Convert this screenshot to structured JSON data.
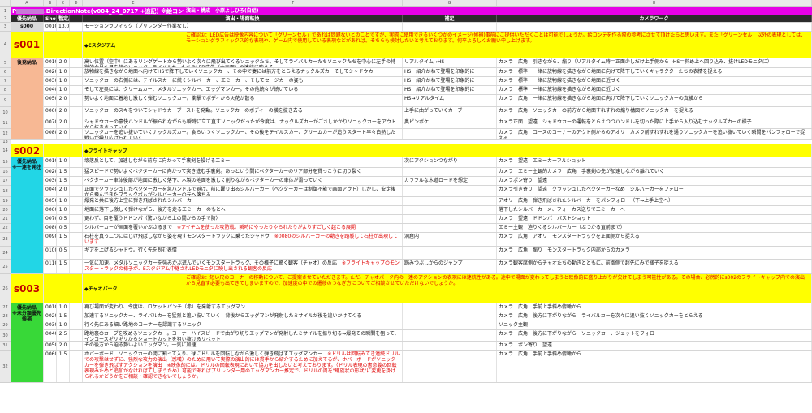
{
  "columns": [
    "A",
    "B",
    "C",
    "D",
    "E",
    "F",
    "G",
    "H"
  ],
  "title": {
    "prefix": "P",
    "name": ".DirectionNote(v004_24_0717 +追記) ※絵コンテ作成用",
    "credit": "演出・構成　小原よしひろ(白組)"
  },
  "headers": [
    "優先納品",
    "Shot",
    "暫定尺",
    "",
    "演出・場面転換",
    "補足",
    "カメラワーク"
  ],
  "rows": [
    {
      "n": 3,
      "kind": "data",
      "h": 11,
      "label": "s000",
      "shot": "0010",
      "dur": "13.0",
      "desc": "モーションラフィック（プリレンダー作業なし）"
    },
    {
      "n": 4,
      "kind": "scene",
      "h": 33,
      "scene": "s001",
      "title": "◆Eスタジアム",
      "note": "ご確認①：LED広告は映像内容について「グリーンセル」であれば問題ないとのことですが、実際に使用できるいくつかのイメージ(候補)事前にご提供いただくことは可能でしょうか。絵コンテを作る際の参考にさせて頂けたらと思います。また「グリーンセル」以外の表現としては、モーショングラフィックス的な表現や、ゲーム内で使用している表現などがあれば。そちらも検討したいと考えております。何卒よろしくお願い申し上げます。"
    },
    {
      "n": 5,
      "kind": "data",
      "h": 12,
      "label": "後発納品",
      "shot": "0010",
      "dur": "2.0",
      "desc": "高い位置（空中）にあるリングゲートから勢いよく次々に飛び出てくるソニックたち。そしてライバルカーたちソニックたちを中心に左手の特徴的な見た目を持つソニック、ライバルカーたちのLED広告（大画面）の連続に映える",
      "g": "リアルタイム→HS",
      "h2": "カメラ　広角　引きながら、煽り（リアルタイム時＝正面少しだけ上手側から→HS＝斜め上ヘ回り込み、抜けLEDモニタに）"
    },
    {
      "n": 6,
      "kind": "data",
      "h": 11,
      "shot": "0020",
      "dur": "1.0",
      "desc": "放物線を描きながら地面へ向けてHSで降下していくソニックカー、その中で妻には前方をとらえるナックルズカーそしてシャドウカー",
      "g": "HS　紹介かねて登場を印象的に",
      "h2": "カメラ　標準　一緒に放物線を描きながら地面に向けて降下していくキャラクターたちの表情を捉える"
    },
    {
      "n": 7,
      "kind": "data",
      "h": 11,
      "shot": "0030",
      "dur": "1.0",
      "desc": "ソニックカーの右側には、テイルスカーに続くシルバーカー、エミーカー、そしてセージカーの姿も",
      "g": "HS　紹介かねて登場を印象的に",
      "h2": "カメラ　標準　一緒に放物線を描きながら地面に近づく"
    },
    {
      "n": 8,
      "kind": "data",
      "h": 11,
      "shot": "0040",
      "dur": "1.0",
      "desc": "そして左奥には、クリームカー、メタルソニックカー、エッグマンカー。その他続々が続いている",
      "g": "HS　紹介かねて登場を印象的に",
      "h2": "カメラ　標準　一緒に放物線を描きながら地面に近づく"
    },
    {
      "n": 9,
      "kind": "data",
      "h": 15,
      "shot": "0050",
      "dur": "2.0",
      "desc": "勢いよく地面に着地し激しく弾むソニックカー。衝撃でボディから火花が散る",
      "g": "HS→リアルタイム",
      "h2": "カメラ　広角　一緒に放物線を描きながら地面に向けて降下していくソニックカーの真横から"
    },
    {
      "n": 10,
      "kind": "data",
      "h": 14,
      "shot": "0060",
      "dur": "2.0",
      "desc": "ソニックカーのスキをついてシャドウカーブーストを発動。ソニックカーのボディーの横を抜き去る",
      "g": "上手に曲がっていくカーブ",
      "h2": "カメラ　広角　ソニックカーの前方から地面すれすれの煽り構図でソニックカーを捉える"
    },
    {
      "n": 11,
      "kind": "data",
      "h": 13,
      "shot": "0070",
      "dur": "2.0",
      "desc": "シャドウカーの豪快ハンドルが振られながらも瞬時に立て直すソニックだったが今度は、ナックルズカーがごさしかかりソニックカーをアウトから抜きさっていく",
      "g": "奥ピンボケ",
      "h2": "カメラ正面　望遠　シャドウカーの運転をとらえつつハンドルを切った際に上手から入り込むナックルズカーの様子"
    },
    {
      "n": 12,
      "kind": "data",
      "h": 13,
      "shot": "0080",
      "dur": "2.0",
      "desc": "ソニックカーを追い抜いていくナックルズカー。食らいつくソニックカー、その後をテイルスカー、クリームカーが追うスタート早々白熱した戦いが繰り広げられていく",
      "g": "",
      "h2": "カメラ　広角　コースのコーナーのアウト側からのアオリ　カメラ前すれすれを通りソニックカーを追い抜いていく瞬間をパンフォローで捉える"
    },
    {
      "n": 13,
      "kind": "spacer",
      "h": 6
    },
    {
      "n": 14,
      "kind": "scene",
      "h": 16,
      "scene": "s002",
      "title": "◆フライトキャップ",
      "note": ""
    },
    {
      "n": 15,
      "kind": "data",
      "h": 13,
      "label": "優先納品\n※一連を発注",
      "shot": "0010",
      "dur": "1.0",
      "desc": "壊落反として、加速しながら前方に向かって手裏剣を投げるエミー",
      "g": "次にアクションつながり",
      "h2": "カメラ　望遠　エミーカーフルショット"
    },
    {
      "n": 16,
      "kind": "data",
      "h": 11,
      "shot": "0020",
      "dur": "1.5",
      "desc": "猛スピードで勢いよくベクターカーに向かって突き進む手裏剣。あっという間にベクターカーのリア部分を貫っこうに切り裂く",
      "g": "",
      "h2": "カメラ　エミー主観的カメラ　広角　手裏剣の先が加速しながら離れていく"
    },
    {
      "n": 17,
      "kind": "data",
      "h": 11,
      "shot": "0030",
      "dur": "1.5",
      "desc": "ベクターカー車体後部が地面に激しく落下、木製の地面を激しく削りながらベクターカーの車体が滑っていく",
      "g": "カラフルな木道ロードを想定",
      "h2": "カメラポン寄り　望遠"
    },
    {
      "n": 18,
      "kind": "data",
      "h": 14,
      "shot": "0040",
      "dur": "2.0",
      "desc": "正面でクラッシュしたベクターカーを急ハンドルで避け、前に躍り出るシルバーカー（ベクターカーは制御不能で画面アウト）しかし、安定後から飛んできたブラックボムがシルバーカーの元へ落ちる",
      "g": "",
      "h2": "カメラ引き寄り　望遠　クラッシュしたベクターカーなめ　シルバーカーをフォロー"
    },
    {
      "n": 19,
      "kind": "data",
      "h": 11,
      "shot": "0050",
      "dur": "1.0",
      "desc": "爆発と共に後方上空に弾き飛ばされたシルバーカー",
      "g": "",
      "h2": "アオリ　広角　弾き飛ばされたシルバーカーをパンフォロー（下→上手上空へ）"
    },
    {
      "n": 20,
      "kind": "data",
      "h": 11,
      "shot": "0060",
      "dur": "1.0",
      "desc": "地面に落下し激しく弾けながら、後方を走るエミーカーのもとへ",
      "g": "",
      "h2": "落下したシルバーカーメ、フォーカス送りでエミーカーへ"
    },
    {
      "n": 21,
      "kind": "data",
      "h": 11,
      "shot": "0070",
      "dur": "0.5",
      "desc": "更わず、目を覆うドドンパ（驚いながら上の間からの手で防）",
      "g": "",
      "h2": "カメラ　望遠　ドドンパ　バストショット"
    },
    {
      "n": 22,
      "kind": "data",
      "h": 11,
      "shot": "0080",
      "dur": "0.5",
      "desc": "シルバーカーが画面を覆いかぶさるまで　※アイテムを使った攻防戦。瞬時にやったりやられたりがよりすごしく起こる展開",
      "g": "",
      "h2": "エミー主観　迫りくるシルバーカー（ぶつかる直前まで）"
    },
    {
      "n": 23,
      "kind": "data",
      "h": 17,
      "shot": "0090",
      "dur": "1.5",
      "desc": "石柱を真っ二つにはじけ飛ばしながら姿を現すモンスタートラックに乗ったシャドウ　※0080のシルバーカーの動きを踏襲して石柱が出現しています",
      "g": "洞窟内",
      "h2": "カメラ　広角　アオリ　モンスタートラックを正面側から捉える"
    },
    {
      "n": 24,
      "kind": "data",
      "h": 16,
      "shot": "0100",
      "dur": "0.5",
      "desc": "ギアを上げるシャドウ。行く先を睨む表情",
      "g": "",
      "h2": "カメラ　広角　煽り　モンスタートラック内部からのカメラ"
    },
    {
      "n": 25,
      "kind": "data",
      "h": 18,
      "shot": "0110",
      "dur": "1.5",
      "desc": "一気に加速、メタルソニックカーを強みかぶ進んでいくモンスタートラック、その様子に驚く観客（チャオ）の反応　※フライトキャップのモンスタートラックの様子が、Eスタジアム中継されLEDモニタに映し出される観客の反応",
      "g": "踏みつぶしからのジャンプ",
      "h2": "カメラ観客席側からチャオたちの動きとともに、前衛側で超先にみで様子を捉える"
    },
    {
      "n": 26,
      "kind": "scene",
      "h": 36,
      "scene": "s003",
      "title": "◆チャオパーク",
      "note": "ご確認②：短い尺のコーナーの移動について、ご提案させていただきます。ただ、チャオパーク内の一連のアクションの表現には連続性がある。途中で場面が変わってしまうと映像的に盛り上がりが欠けてしまう可能性がある。その場合、必然的にs002のフライトキャップ内での演出から見直す必要も出てきてしまいますので、加速度の中での遷移のつなぎ方についてご相談させていただけないでしょうか。"
    },
    {
      "n": 27,
      "kind": "data",
      "h": 11,
      "label": "優先納品\n※未分類優先候補",
      "shot": "0010",
      "dur": "1.0",
      "desc": "再び場面が変わり、今度は、ロケットパンチ（赤）を発射するエッグマン",
      "g": "",
      "h2": "カメラ　広角　手前上手斜め俯瞰から"
    },
    {
      "n": 28,
      "kind": "data",
      "h": 11,
      "shot": "0020",
      "dur": "1.5",
      "desc": "加速するソニックカー、ライバルカーを猛烈と追い抜いていく　背後からエッグマンが発射したミサイルが後を追いかけてくる",
      "g": "",
      "h2": "カメラ　広角　後方に下がりながら　ライバルカーを次々に追い抜くソニックカーをとらえる"
    },
    {
      "n": 29,
      "kind": "data",
      "h": 11,
      "shot": "0030",
      "dur": "1.0",
      "desc": "行く先にある細い路地のコーナーを認識するソニック",
      "g": "",
      "h2": "ソニック主観"
    },
    {
      "n": 30,
      "kind": "data",
      "h": 14,
      "shot": "0040",
      "dur": "2.5",
      "desc": "路地裏のカーブを攻めるソニックカー。コーナーハイスピードで曲がり切りエッグマンが発射したミサイルを振り切る→爆発その瞬間を狙って、インコースギリギリからショートカットを狙い抜けるリベット",
      "g": "",
      "h2": "カメラ　広角　後方に下がりながら　ソニックカー、ジェットをフォロー"
    },
    {
      "n": 31,
      "kind": "data",
      "h": 11,
      "shot": "0050",
      "dur": "2.0",
      "desc": "その後方から迫る勢いよいエッグマン。一気に加速",
      "g": "",
      "h2": "カメラ　ポン寄り　望遠"
    },
    {
      "n": 32,
      "kind": "data",
      "h": 40,
      "shot": "0060",
      "dur": "1.5",
      "desc": "ホバーボード、ソニックカーの間に割って入り、球にドリルを回転しながら激しく弾き飛ばすエッグマンカー　※ドリルは回転みてき連続ドリルでの攻撃はせずに、強烈な攻力の演出（感嘆）のために用いて実際の演出的には貫手から紹介するために加えてるが、ホバーボードがソニックカーを弾き飛ばすアクションを演出　※映像的には、ドリルの回転表現において協力を出したいと考えております。（ドリル表現の書意義の回転表現みためと追加がなければてしまうため）可能であればプリレンダー用のエッグマンカー推定で、ドリルの周を\"螺旋状の形状\"に変更を掛けられるかどうかをご相談・確認できないでしょうか。",
      "g": "",
      "h2": "カメラ　広角　手前上手斜め俯瞰から"
    }
  ]
}
